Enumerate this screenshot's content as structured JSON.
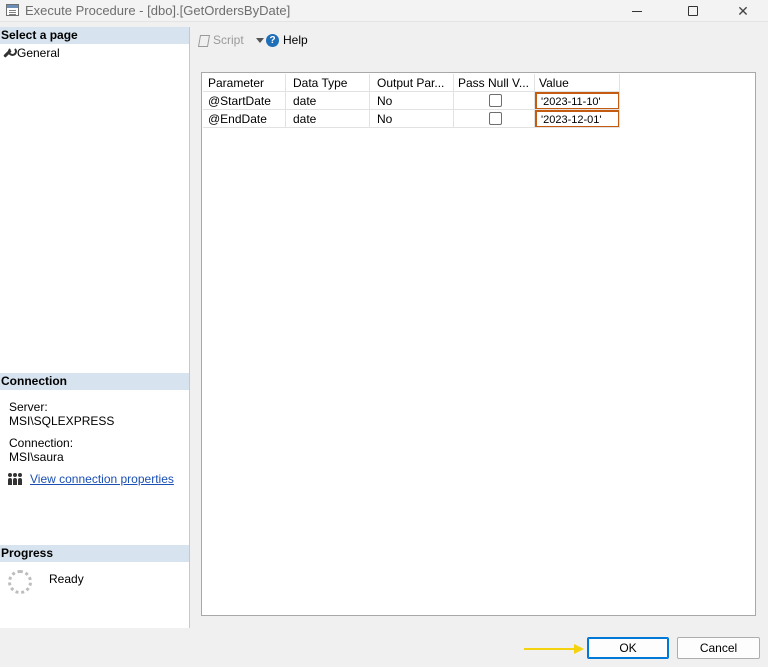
{
  "window": {
    "title": "Execute Procedure - [dbo].[GetOrdersByDate]"
  },
  "left_pane": {
    "select_page_header": "Select a page",
    "pages": [
      {
        "label": "General",
        "icon": "wrench-icon"
      }
    ],
    "connection_header": "Connection",
    "server_label": "Server:",
    "server_value": "MSI\\SQLEXPRESS",
    "connection_label": "Connection:",
    "connection_value": "MSI\\saura",
    "view_connection_link": "View connection properties",
    "progress_header": "Progress",
    "progress_status": "Ready"
  },
  "toolbar": {
    "script_label": "Script",
    "help_label": "Help"
  },
  "grid": {
    "columns": [
      "Parameter",
      "Data Type",
      "Output Par...",
      "Pass Null V...",
      "Value"
    ],
    "rows": [
      {
        "parameter": "@StartDate",
        "data_type": "date",
        "output": "No",
        "pass_null": false,
        "value": "'2023-11-10'"
      },
      {
        "parameter": "@EndDate",
        "data_type": "date",
        "output": "No",
        "pass_null": false,
        "value": "'2023-12-01'"
      }
    ]
  },
  "buttons": {
    "ok": "OK",
    "cancel": "Cancel"
  },
  "colors": {
    "section_header_bg": "#d7e3ee",
    "highlight_border": "#c55a11",
    "annotation_arrow": "#f5d20f",
    "link": "#1a4fb3",
    "default_button_border": "#0078d7"
  }
}
